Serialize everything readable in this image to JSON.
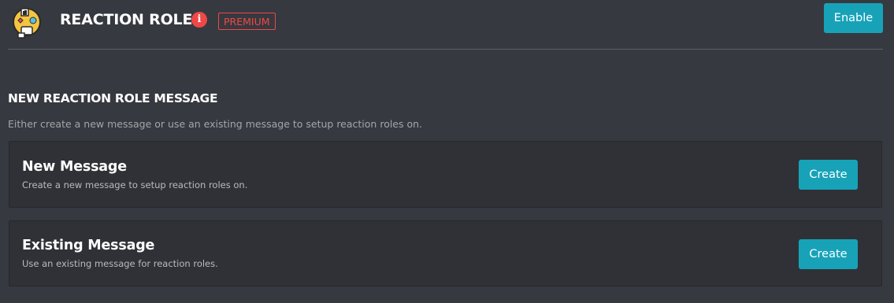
{
  "header": {
    "title": "REACTION ROLES",
    "info_icon_glyph": "i",
    "premium_label": "PREMIUM",
    "enable_label": "Enable",
    "logo_icon": "reaction-roles-logo-icon"
  },
  "section": {
    "title": "NEW REACTION ROLE MESSAGE",
    "description": "Either create a new message or use an existing message to setup reaction roles on."
  },
  "cards": [
    {
      "title": "New Message",
      "description": "Create a new message to setup reaction roles on.",
      "button_label": "Create"
    },
    {
      "title": "Existing Message",
      "description": "Use an existing message for reaction roles.",
      "button_label": "Create"
    }
  ],
  "colors": {
    "background": "#36393f",
    "card_background": "#2f3136",
    "accent": "#17a2b8",
    "premium": "#f04747"
  }
}
